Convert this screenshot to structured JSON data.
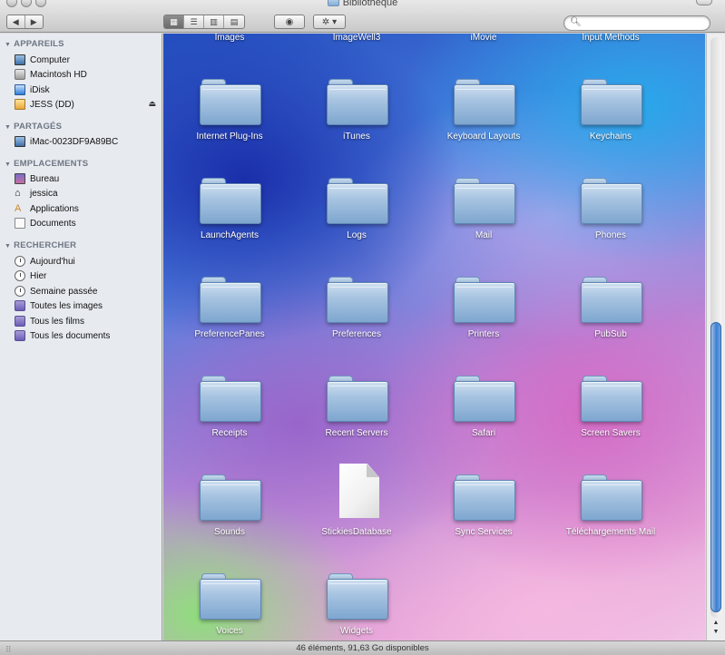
{
  "window": {
    "title": "Bibliothèque"
  },
  "toolbar": {
    "nav": [
      "◀",
      "▶"
    ],
    "views": [
      "▦",
      "☰",
      "▥",
      "▤"
    ],
    "eye_icon": "◉",
    "gear_icon": "✲ ▾",
    "search": {
      "value": "",
      "placeholder": ""
    }
  },
  "sidebar": {
    "sections": [
      {
        "title": "APPAREILS",
        "items": [
          {
            "label": "Computer",
            "icon": "monitor-icon"
          },
          {
            "label": "Macintosh HD",
            "icon": "hard-drive-icon"
          },
          {
            "label": "iDisk",
            "icon": "idisk-icon"
          },
          {
            "label": "JESS (DD)",
            "icon": "usb-drive-icon",
            "eject": "⏏"
          }
        ]
      },
      {
        "title": "PARTAGÉS",
        "items": [
          {
            "label": "iMac-0023DF9A89BC",
            "icon": "monitor-icon"
          }
        ]
      },
      {
        "title": "EMPLACEMENTS",
        "items": [
          {
            "label": "Bureau",
            "icon": "desktop-icon"
          },
          {
            "label": "jessica",
            "icon": "home-icon"
          },
          {
            "label": "Applications",
            "icon": "applications-icon"
          },
          {
            "label": "Documents",
            "icon": "documents-icon"
          }
        ]
      },
      {
        "title": "RECHERCHER",
        "items": [
          {
            "label": "Aujourd'hui",
            "icon": "clock-icon"
          },
          {
            "label": "Hier",
            "icon": "clock-icon"
          },
          {
            "label": "Semaine passée",
            "icon": "clock-icon"
          },
          {
            "label": "Toutes les images",
            "icon": "smart-folder-icon"
          },
          {
            "label": "Tous les films",
            "icon": "smart-folder-icon"
          },
          {
            "label": "Tous les documents",
            "icon": "smart-folder-icon"
          }
        ]
      }
    ]
  },
  "files": {
    "top_row": [
      "Images",
      "ImageWell3",
      "iMovie",
      "Input Methods"
    ],
    "items": [
      {
        "name": "Internet Plug-Ins",
        "kind": "folder"
      },
      {
        "name": "iTunes",
        "kind": "folder"
      },
      {
        "name": "Keyboard Layouts",
        "kind": "folder"
      },
      {
        "name": "Keychains",
        "kind": "folder"
      },
      {
        "name": "LaunchAgents",
        "kind": "folder"
      },
      {
        "name": "Logs",
        "kind": "folder"
      },
      {
        "name": "Mail",
        "kind": "folder"
      },
      {
        "name": "Phones",
        "kind": "folder"
      },
      {
        "name": "PreferencePanes",
        "kind": "folder"
      },
      {
        "name": "Preferences",
        "kind": "folder"
      },
      {
        "name": "Printers",
        "kind": "folder"
      },
      {
        "name": "PubSub",
        "kind": "folder"
      },
      {
        "name": "Receipts",
        "kind": "folder"
      },
      {
        "name": "Recent Servers",
        "kind": "folder"
      },
      {
        "name": "Safari",
        "kind": "folder"
      },
      {
        "name": "Screen Savers",
        "kind": "folder"
      },
      {
        "name": "Sounds",
        "kind": "folder"
      },
      {
        "name": "StickiesDatabase",
        "kind": "document"
      },
      {
        "name": "Sync Services",
        "kind": "folder"
      },
      {
        "name": "Téléchargements Mail",
        "kind": "folder"
      },
      {
        "name": "Voices",
        "kind": "folder"
      },
      {
        "name": "Widgets",
        "kind": "folder"
      }
    ]
  },
  "scrollbar": {
    "up_arrow": "▲",
    "down_arrow": "▼"
  },
  "status": {
    "text": "46 éléments, 91,63 Go disponibles"
  }
}
